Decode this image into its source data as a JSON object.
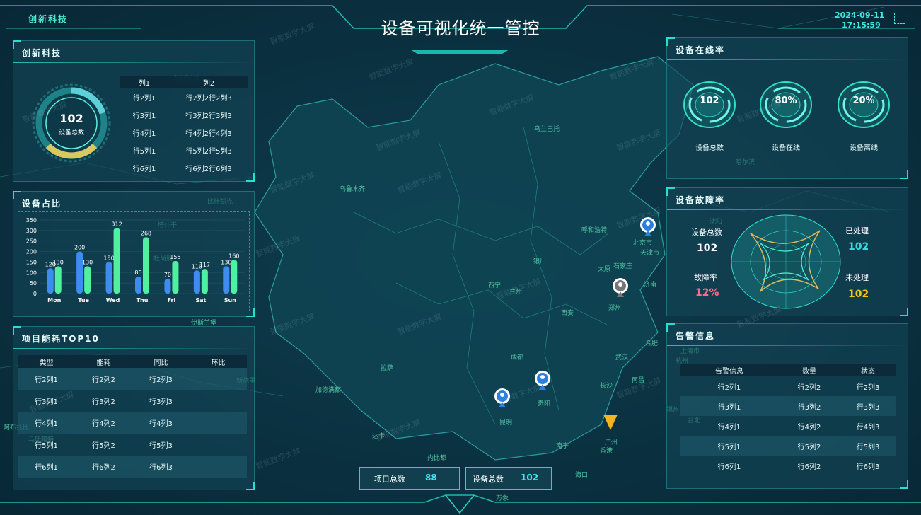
{
  "header": {
    "brand": "创新科技",
    "title": "设备可视化统一管控",
    "date": "2024-09-11",
    "time": "17:15:59"
  },
  "panel1": {
    "title": "创新科技",
    "total_value": "102",
    "total_label": "设备总数",
    "table": {
      "headers": [
        "列1",
        "列2"
      ],
      "rows": [
        [
          "行2列1",
          "行2列2行2列3"
        ],
        [
          "行3列1",
          "行3列2行3列3"
        ],
        [
          "行4列1",
          "行4列2行4列3"
        ],
        [
          "行5列1",
          "行5列2行5列3"
        ],
        [
          "行6列1",
          "行6列2行6列3"
        ]
      ]
    }
  },
  "panel2": {
    "title": "设备占比"
  },
  "chart_data": {
    "type": "bar",
    "categories": [
      "Mon",
      "Tue",
      "Wed",
      "Thu",
      "Fri",
      "Sat",
      "Sun"
    ],
    "series": [
      {
        "values": [
          120,
          200,
          150,
          80,
          70,
          110,
          130
        ],
        "color": "#3f8cf0"
      },
      {
        "values": [
          130,
          130,
          312,
          268,
          155,
          117,
          160
        ],
        "color": "#4ff0a0"
      }
    ],
    "yticks": [
      0,
      50,
      100,
      150,
      200,
      250,
      300,
      350
    ],
    "ylim": [
      0,
      350
    ]
  },
  "panel3": {
    "title": "项目能耗TOP10",
    "headers": [
      "类型",
      "能耗",
      "同比",
      "环比"
    ],
    "rows": [
      [
        "行2列1",
        "行2列2",
        "行2列3",
        ""
      ],
      [
        "行3列1",
        "行3列2",
        "行3列3",
        ""
      ],
      [
        "行4列1",
        "行4列2",
        "行4列3",
        ""
      ],
      [
        "行5列1",
        "行5列2",
        "行5列3",
        ""
      ],
      [
        "行6列1",
        "行6列2",
        "行6列3",
        ""
      ]
    ]
  },
  "panel4": {
    "title": "设备在线率",
    "items": [
      {
        "value": "102",
        "label": "设备总数"
      },
      {
        "value": "80%",
        "label": "设备在线"
      },
      {
        "value": "20%",
        "label": "设备离线"
      }
    ]
  },
  "panel5": {
    "title": "设备故障率",
    "total_label": "设备总数",
    "total_value": "102",
    "rate_label": "故障率",
    "rate_value": "12%",
    "handled_label": "已处理",
    "handled_value": "102",
    "unhandled_label": "未处理",
    "unhandled_value": "102",
    "colors": {
      "handled": "#2fe0d8",
      "unhandled": "#f5c518",
      "rate": "#ff6b8a"
    }
  },
  "panel6": {
    "title": "告警信息",
    "headers": [
      "告警信息",
      "数量",
      "状态"
    ],
    "rows": [
      [
        "行2列1",
        "行2列2",
        "行2列3"
      ],
      [
        "行3列1",
        "行3列2",
        "行3列3"
      ],
      [
        "行4列1",
        "行4列2",
        "行4列3"
      ],
      [
        "行5列1",
        "行5列2",
        "行5列3"
      ],
      [
        "行6列1",
        "行6列2",
        "行6列3"
      ]
    ]
  },
  "bottom": {
    "projects_label": "项目总数",
    "projects_value": "88",
    "devices_label": "设备总数",
    "devices_value": "102"
  },
  "map_labels": [
    "乌兰巴托",
    "乌鲁木齐",
    "呼和浩特",
    "北京市",
    "天津市",
    "银川",
    "太原",
    "石家庄",
    "西宁",
    "兰州",
    "济南",
    "郑州",
    "西安",
    "拉萨",
    "成都",
    "贵阳",
    "昆明",
    "南宁",
    "广州",
    "香港",
    "海口",
    "武汉",
    "南昌",
    "长沙",
    "合肥",
    "杭州",
    "上海市",
    "哈尔滨",
    "沈阳",
    "台北",
    "福州",
    "阿斯塔纳",
    "比什凯克",
    "塔什干",
    "杜尚别",
    "伊斯兰堡",
    "新德里",
    "加德满都",
    "达卡",
    "内比都",
    "万象",
    "阿布扎比",
    "马斯喀特"
  ],
  "watermark": "智能数字大屏"
}
